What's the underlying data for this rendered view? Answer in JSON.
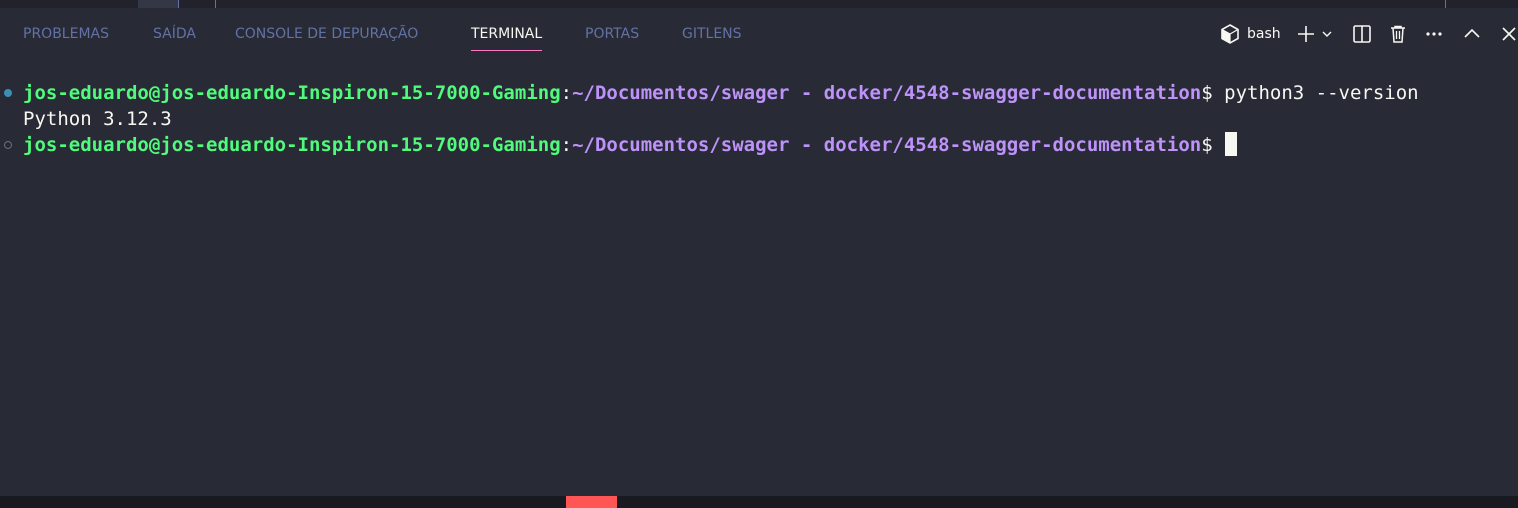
{
  "panel": {
    "tabs": [
      {
        "label": "PROBLEMAS"
      },
      {
        "label": "SAÍDA"
      },
      {
        "label": "CONSOLE DE DEPURAÇÃO"
      },
      {
        "label": "TERMINAL",
        "active": true
      },
      {
        "label": "PORTAS"
      },
      {
        "label": "GITLENS"
      }
    ],
    "shell": {
      "name": "bash",
      "icon": "terminal-bash-icon"
    },
    "actions": [
      "add-terminal-icon",
      "chevron-down-icon",
      "split-terminal-icon",
      "trash-icon",
      "more-actions-icon",
      "maximize-panel-icon",
      "close-panel-icon"
    ]
  },
  "terminal": {
    "lines": [
      {
        "decoration": "success",
        "user": "jos-eduardo@jos-eduardo-Inspiron-15-7000-Gaming",
        "sep": ":",
        "path": "~/Documentos/swager - docker/4548-swagger-documentation",
        "prompt": "$",
        "command": " python3 --version"
      },
      {
        "output": "Python 3.12.3"
      },
      {
        "decoration": "empty",
        "user": "jos-eduardo@jos-eduardo-Inspiron-15-7000-Gaming",
        "sep": ":",
        "path": "~/Documentos/swager - docker/4548-swagger-documentation",
        "prompt": "$",
        "command": ""
      }
    ]
  },
  "colors": {
    "background": "#282a36",
    "user": "#50fa7b",
    "path": "#bd93f9",
    "tab_active_underline": "#ff79c6",
    "tab_inactive": "#6272a4",
    "error_status": "#ff5555"
  }
}
